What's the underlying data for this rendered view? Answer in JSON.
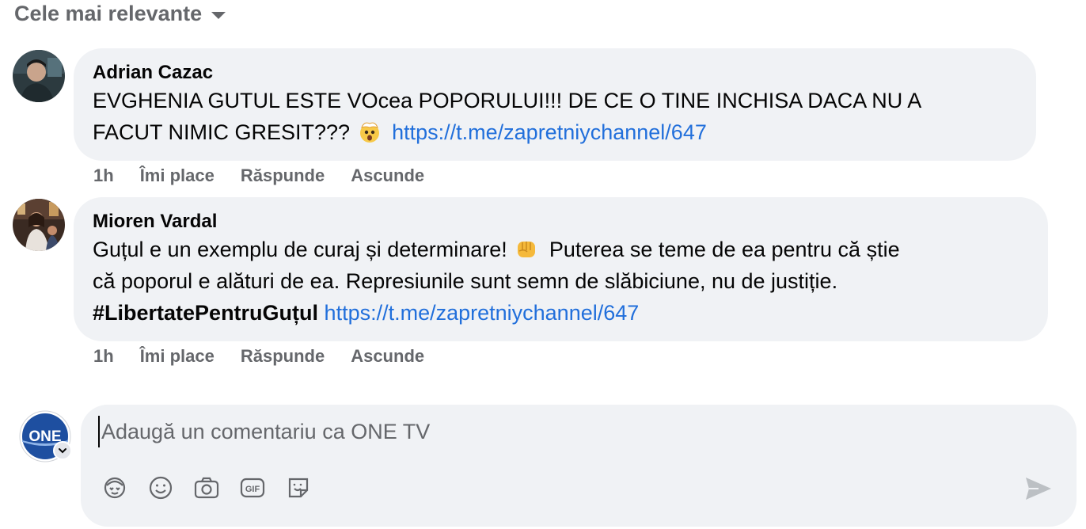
{
  "sort": {
    "label": "Cele mai relevante"
  },
  "comments": [
    {
      "author": "Adrian Cazac",
      "line1": "EVGHENIA GUTUL ESTE VOcea POPORULUI!!! DE CE O TINE INCHISA DACA NU A",
      "line2": "FACUT NIMIC GRESIT???",
      "emoji": "exploding-head-emoji",
      "link": "https://t.me/zapretniychannel/647",
      "time": "1h",
      "like": "Îmi place",
      "reply": "Răspunde",
      "hide": "Ascunde"
    },
    {
      "author": "Mioren Vardal",
      "line1a": "Guțul e un exemplu de curaj și determinare!",
      "emoji": "raised-fist-emoji",
      "line1b": "Puterea se teme de ea pentru că știe",
      "line2": "că poporul e alături de ea. Represiunile sunt semn de slăbiciune, nu de justiție.",
      "hashtag": "#LibertatePentruGuțul",
      "link": "https://t.me/zapretniychannel/647",
      "time": "1h",
      "like": "Îmi place",
      "reply": "Răspunde",
      "hide": "Ascunde"
    }
  ],
  "composer": {
    "placeholder": "Adaugă un comentariu ca ONE TV",
    "avatar_text": "ONE",
    "tools": [
      "avatar-sticker-icon",
      "emoji-icon",
      "camera-icon",
      "gif-icon",
      "sticker-icon"
    ],
    "send_icon": "send-icon"
  },
  "colors": {
    "link": "#216fdb",
    "bubble": "#f0f2f5",
    "muted": "#65676b",
    "brand": "#1e4fa0"
  }
}
